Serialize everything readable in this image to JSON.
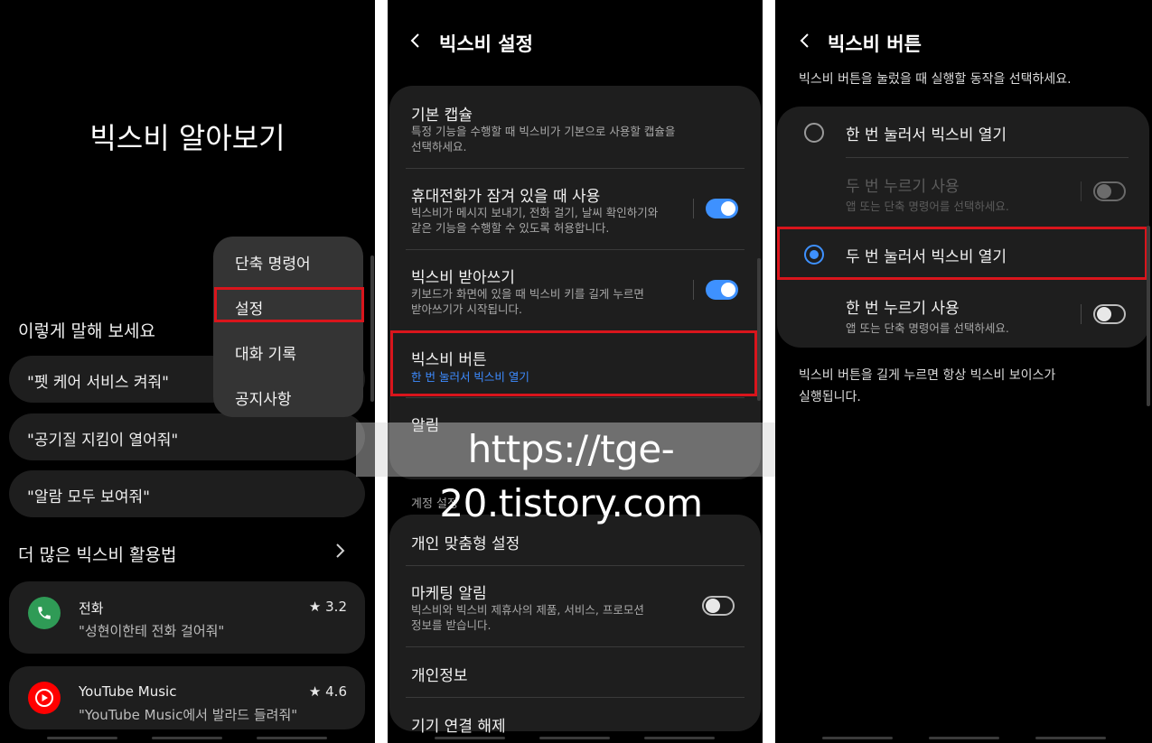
{
  "panel1": {
    "title": "빅스비 알아보기",
    "try_saying": "이렇게 말해 보세요",
    "phrases": [
      "\"펫 케어 서비스 켜줘\"",
      "\"공기질 지킴이 열어줘\"",
      "\"알람 모두 보여줘\""
    ],
    "more_tips": "더 많은 빅스비 활용법",
    "apps": [
      {
        "name": "전화",
        "rating": "3.2",
        "example": "\"성현이한테 전화 걸어줘\"",
        "icon": "phone-icon",
        "color": "#2f9b56"
      },
      {
        "name": "YouTube Music",
        "rating": "4.6",
        "example": "\"YouTube Music에서 발라드 들려줘\"",
        "icon": "youtube-music-icon",
        "color": "#ff0000"
      }
    ],
    "menu": [
      "단축 명령어",
      "설정",
      "대화 기록",
      "공지사항"
    ]
  },
  "panel2": {
    "title": "빅스비 설정",
    "rows": [
      {
        "title": "기본 캡슐",
        "sub": "특정 기능을 수행할 때 빅스비가 기본으로 사용할 캡슐을\n선택하세요."
      },
      {
        "title": "휴대전화가 잠겨 있을 때 사용",
        "sub": "빅스비가 메시지 보내기, 전화 걸기, 날씨 확인하기와\n같은 기능을 수행할 수 있도록 허용합니다."
      },
      {
        "title": "빅스비 받아쓰기",
        "sub": "키보드가 화면에 있을 때 빅스비 키를 길게 누르면\n받아쓰기가 시작됩니다."
      },
      {
        "title": "빅스비 버튼",
        "sub": "한 번 눌러서 빅스비 열기"
      },
      {
        "title": "알림",
        "sub": ""
      }
    ],
    "account_section": "계정 설정",
    "account_rows": [
      {
        "title": "개인 맞춤형 설정"
      },
      {
        "title": "마케팅 알림",
        "sub": "빅스비와 빅스비 제휴사의 제품, 서비스, 프로모션\n정보를 받습니다."
      },
      {
        "title": "개인정보"
      },
      {
        "title": "기기 연결 해제"
      }
    ],
    "toggles": {
      "lock_screen": true,
      "dictation": true,
      "marketing": false
    }
  },
  "panel3": {
    "title": "빅스비 버튼",
    "description": "빅스비 버튼을 눌렀을 때 실행할 동작을 선택하세요.",
    "option_single": "한 번 눌러서 빅스비 열기",
    "sub_double_use": "두 번 누르기 사용",
    "sub_double_desc": "앱 또는 단축 명령어를 선택하세요.",
    "option_double": "두 번 눌러서 빅스비 열기",
    "sub_single_use": "한 번 누르기 사용",
    "sub_single_desc": "앱 또는 단축 명령어를 선택하세요.",
    "footer": "빅스비 버튼을 길게 누르면 항상 빅스비 보이스가\n실행됩니다.",
    "selected": "double"
  },
  "watermark": "https://tge-20.tistory.com",
  "colors": {
    "accent": "#3e91ff",
    "highlight": "#d9151c"
  }
}
